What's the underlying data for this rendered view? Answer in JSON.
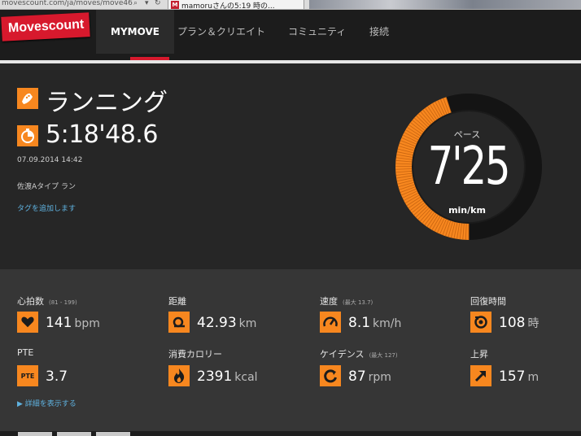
{
  "browser": {
    "url": "movescount.com/ja/moves/move46",
    "tab_title": "mamoruさんの5:19 時の...",
    "tab_favicon": "M"
  },
  "nav": {
    "logo": "Movescount",
    "items": [
      "MYMOVE",
      "プラン＆クリエイト",
      "コミュニティ",
      "接続"
    ]
  },
  "move": {
    "sport": "ランニング",
    "duration": "5:18'48.6",
    "datetime": "07.09.2014 14:42",
    "location": "佐渡Aタイプ ラン",
    "add_tag": "タグを追加します"
  },
  "pace": {
    "label": "ペース",
    "value": "7'25",
    "unit": "min/km",
    "gauge_fraction": 0.45,
    "accent": "#f7871f"
  },
  "stats": [
    {
      "label": "心拍数",
      "sub": "(81 - 199)",
      "value": "141",
      "unit": "bpm",
      "icon": "heart-icon"
    },
    {
      "label": "距離",
      "sub": "",
      "value": "42.93",
      "unit": "km",
      "icon": "distance-icon"
    },
    {
      "label": "速度",
      "sub": "(最大 13.7)",
      "value": "8.1",
      "unit": "km/h",
      "icon": "speedometer-icon"
    },
    {
      "label": "回復時間",
      "sub": "",
      "value": "108",
      "unit": "時",
      "icon": "recovery-icon"
    },
    {
      "label": "PTE",
      "sub": "",
      "value": "3.7",
      "unit": "",
      "icon": "pte-icon",
      "icon_text": "PTE"
    },
    {
      "label": "消費カロリー",
      "sub": "",
      "value": "2391",
      "unit": "kcal",
      "icon": "flame-icon"
    },
    {
      "label": "ケイデンス",
      "sub": "(最大 127)",
      "value": "87",
      "unit": "rpm",
      "icon": "cadence-icon"
    },
    {
      "label": "上昇",
      "sub": "",
      "value": "157",
      "unit": "m",
      "icon": "ascent-arrow-icon"
    }
  ],
  "show_details": "▶ 詳細を表示する"
}
